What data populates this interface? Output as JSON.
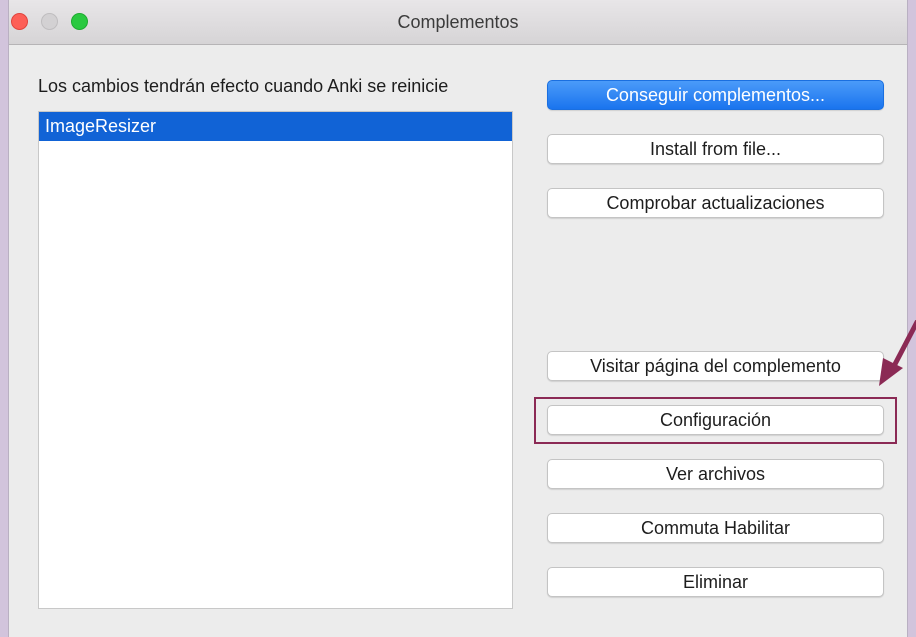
{
  "window": {
    "title": "Complementos"
  },
  "notice": "Los cambios tendrán efecto cuando Anki se reinicie",
  "addons": [
    {
      "name": "ImageResizer",
      "selected": true
    }
  ],
  "buttons": {
    "get_addons": "Conseguir complementos...",
    "install_from_file": "Install from file...",
    "check_updates": "Comprobar actualizaciones",
    "visit_page": "Visitar página del complemento",
    "config": "Configuración",
    "view_files": "Ver archivos",
    "toggle_enabled": "Commuta Habilitar",
    "delete": "Eliminar"
  },
  "colors": {
    "accent": "#1163d6",
    "annotation": "#8b2a55"
  },
  "icons": {
    "close": "close-icon",
    "minimize": "minimize-icon",
    "maximize": "maximize-icon",
    "annotation_arrow": "arrow-icon"
  }
}
